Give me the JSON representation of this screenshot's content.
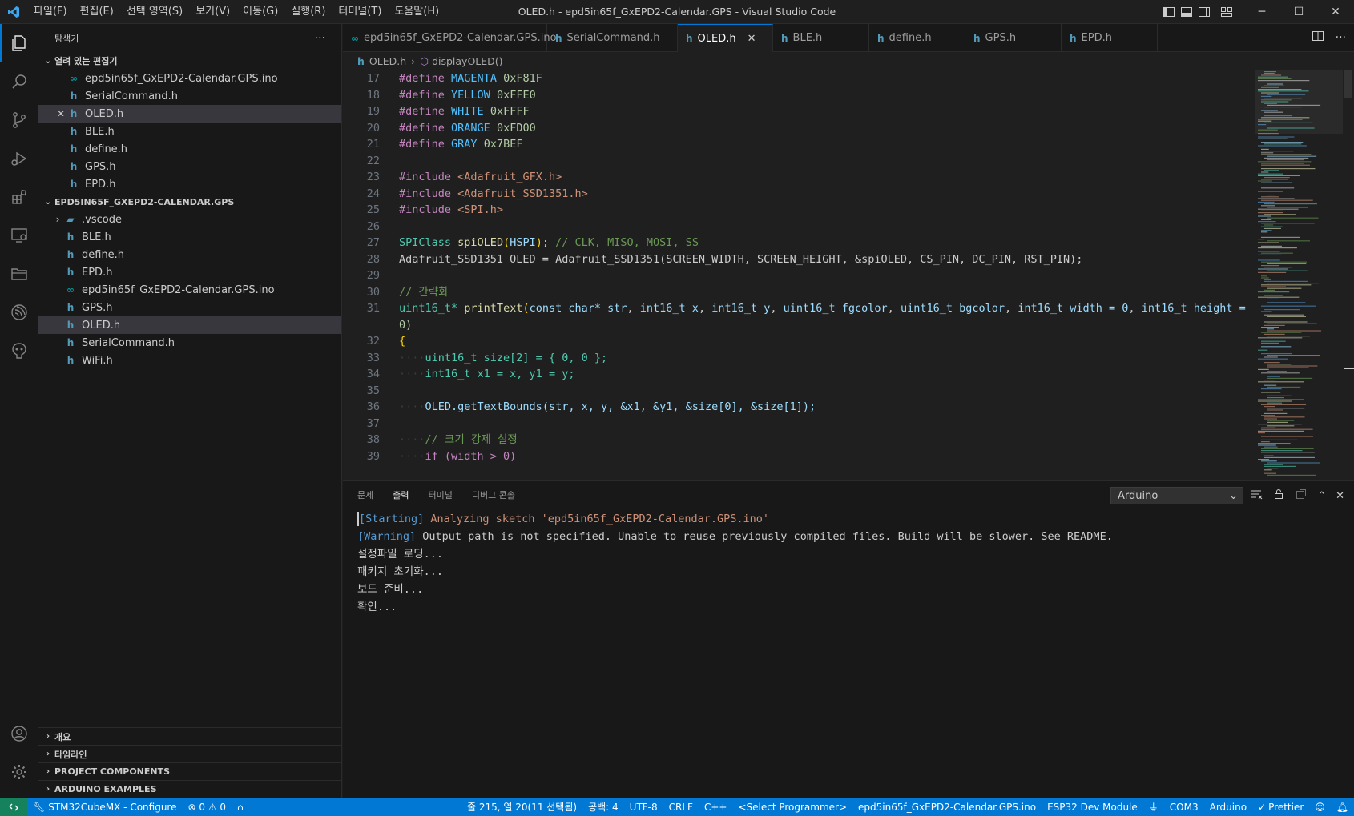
{
  "titlebar": {
    "menu": [
      "파일(F)",
      "편집(E)",
      "선택 영역(S)",
      "보기(V)",
      "이동(G)",
      "실행(R)",
      "터미널(T)",
      "도움말(H)"
    ],
    "window_title": "OLED.h - epd5in65f_GxEPD2-Calendar.GPS - Visual Studio Code"
  },
  "sidebar": {
    "title": "탐색기",
    "open_editors": {
      "label": "열려 있는 편집기",
      "items": [
        {
          "name": "epd5in65f_GxEPD2-Calendar.GPS.ino",
          "icon": "ino-icon"
        },
        {
          "name": "SerialCommand.h",
          "icon": "h-file-icon"
        },
        {
          "name": "OLED.h",
          "icon": "h-file-icon"
        },
        {
          "name": "BLE.h",
          "icon": "h-file-icon"
        },
        {
          "name": "define.h",
          "icon": "h-file-icon"
        },
        {
          "name": "GPS.h",
          "icon": "h-file-icon"
        },
        {
          "name": "EPD.h",
          "icon": "h-file-icon"
        }
      ]
    },
    "workspace": {
      "label": "EPD5IN65F_GXEPD2-CALENDAR.GPS",
      "items": [
        {
          "name": ".vscode",
          "icon": "folder-icon"
        },
        {
          "name": "BLE.h",
          "icon": "h-file-icon"
        },
        {
          "name": "define.h",
          "icon": "h-file-icon"
        },
        {
          "name": "EPD.h",
          "icon": "h-file-icon"
        },
        {
          "name": "epd5in65f_GxEPD2-Calendar.GPS.ino",
          "icon": "ino-icon"
        },
        {
          "name": "GPS.h",
          "icon": "h-file-icon"
        },
        {
          "name": "OLED.h",
          "icon": "h-file-icon"
        },
        {
          "name": "SerialCommand.h",
          "icon": "h-file-icon"
        },
        {
          "name": "WiFi.h",
          "icon": "h-file-icon"
        }
      ]
    },
    "bottom_sections": [
      "개요",
      "타임라인",
      "PROJECT COMPONENTS",
      "ARDUINO EXAMPLES"
    ]
  },
  "tabs": [
    {
      "name": "epd5in65f_GxEPD2-Calendar.GPS.ino",
      "icon": "ino-icon"
    },
    {
      "name": "SerialCommand.h",
      "icon": "h-file-icon"
    },
    {
      "name": "OLED.h",
      "icon": "h-file-icon"
    },
    {
      "name": "BLE.h",
      "icon": "h-file-icon"
    },
    {
      "name": "define.h",
      "icon": "h-file-icon"
    },
    {
      "name": "GPS.h",
      "icon": "h-file-icon"
    },
    {
      "name": "EPD.h",
      "icon": "h-file-icon"
    }
  ],
  "breadcrumb": {
    "file": "OLED.h",
    "symbol": "displayOLED()"
  },
  "editor": {
    "line_numbers": [
      "17",
      "18",
      "19",
      "20",
      "21",
      "22",
      "23",
      "24",
      "25",
      "26",
      "27",
      "28",
      "29",
      "30",
      "31",
      "",
      "32",
      "33",
      "34",
      "35",
      "36",
      "37",
      "38",
      "39"
    ],
    "l17": {
      "kw": "#define",
      "name": "MAGENTA",
      "val": "0xF81F"
    },
    "l18": {
      "kw": "#define",
      "name": "YELLOW",
      "val": "0xFFE0"
    },
    "l19": {
      "kw": "#define",
      "name": "WHITE",
      "val": "0xFFFF"
    },
    "l20": {
      "kw": "#define",
      "name": "ORANGE",
      "val": "0xFD00"
    },
    "l21": {
      "kw": "#define",
      "name": "GRAY",
      "val": "0x7BEF"
    },
    "l23": {
      "kw": "#include",
      "hdr": "<Adafruit_GFX.h>"
    },
    "l24": {
      "kw": "#include",
      "hdr": "<Adafruit_SSD1351.h>"
    },
    "l25": {
      "kw": "#include",
      "hdr": "<SPI.h>"
    },
    "l27": {
      "type": "SPIClass",
      "fn": "spiOLED",
      "arg": "HSPI",
      "comment": "// CLK, MISO, MOSI, SS"
    },
    "l28": {
      "text": "Adafruit_SSD1351 OLED = Adafruit_SSD1351(SCREEN_WIDTH, SCREEN_HEIGHT, &spiOLED, CS_PIN, DC_PIN, RST_PIN);"
    },
    "l30": {
      "comment": "// 간략화"
    },
    "l31": {
      "ret": "uint16_t*",
      "fn": "printText",
      "p1": "const char* str",
      "p2": "int16_t x",
      "p3": "int16_t y",
      "p4": "uint16_t fgcolor",
      "p5": "uint16_t bgcolor",
      "p6": "int16_t width = 0",
      "p7": "int16_t height =",
      "wrap": "0)"
    },
    "l32": {
      "text": "{"
    },
    "l33": {
      "text": "uint16_t size[2] = { 0, 0 };"
    },
    "l34": {
      "text": "int16_t x1 = x, y1 = y;"
    },
    "l36": {
      "text": "OLED.getTextBounds(str, x, y, &x1, &y1, &size[0], &size[1]);"
    },
    "l38": {
      "comment": "// 크기 강제 설정"
    },
    "l39": {
      "text": "if (width > 0)"
    }
  },
  "panel": {
    "tabs": [
      "문제",
      "출력",
      "터미널",
      "디버그 콘솔"
    ],
    "active_tab": "출력",
    "channel": "Arduino",
    "output": {
      "line1_tag": "[Starting]",
      "line1_text": " Analyzing sketch ",
      "line1_file": "'epd5in65f_GxEPD2-Calendar.GPS.ino'",
      "line2_tag": "[Warning]",
      "line2_text": " Output path is not specified. Unable to reuse previously compiled files. Build will be slower. See README.",
      "lines": [
        "설정파일 로딩...",
        "패키지 초기화...",
        "보드 준비...",
        "확인..."
      ]
    }
  },
  "statusbar": {
    "left": [
      "STM32CubeMX - Configure",
      "⊗ 0 ⚠ 0"
    ],
    "right": [
      "줄 215, 열 20(11 선택됨)",
      "공백: 4",
      "UTF-8",
      "CRLF",
      "C++",
      "<Select Programmer>",
      "epd5in65f_GxEPD2-Calendar.GPS.ino",
      "ESP32 Dev Module",
      "COM3",
      "Arduino",
      "Prettier"
    ]
  },
  "colors": {
    "accent": "#0078d4",
    "statusbar": "#0078d4",
    "remote": "#16825d",
    "editor_bg": "#1f1f1f",
    "sidebar_bg": "#181818"
  }
}
